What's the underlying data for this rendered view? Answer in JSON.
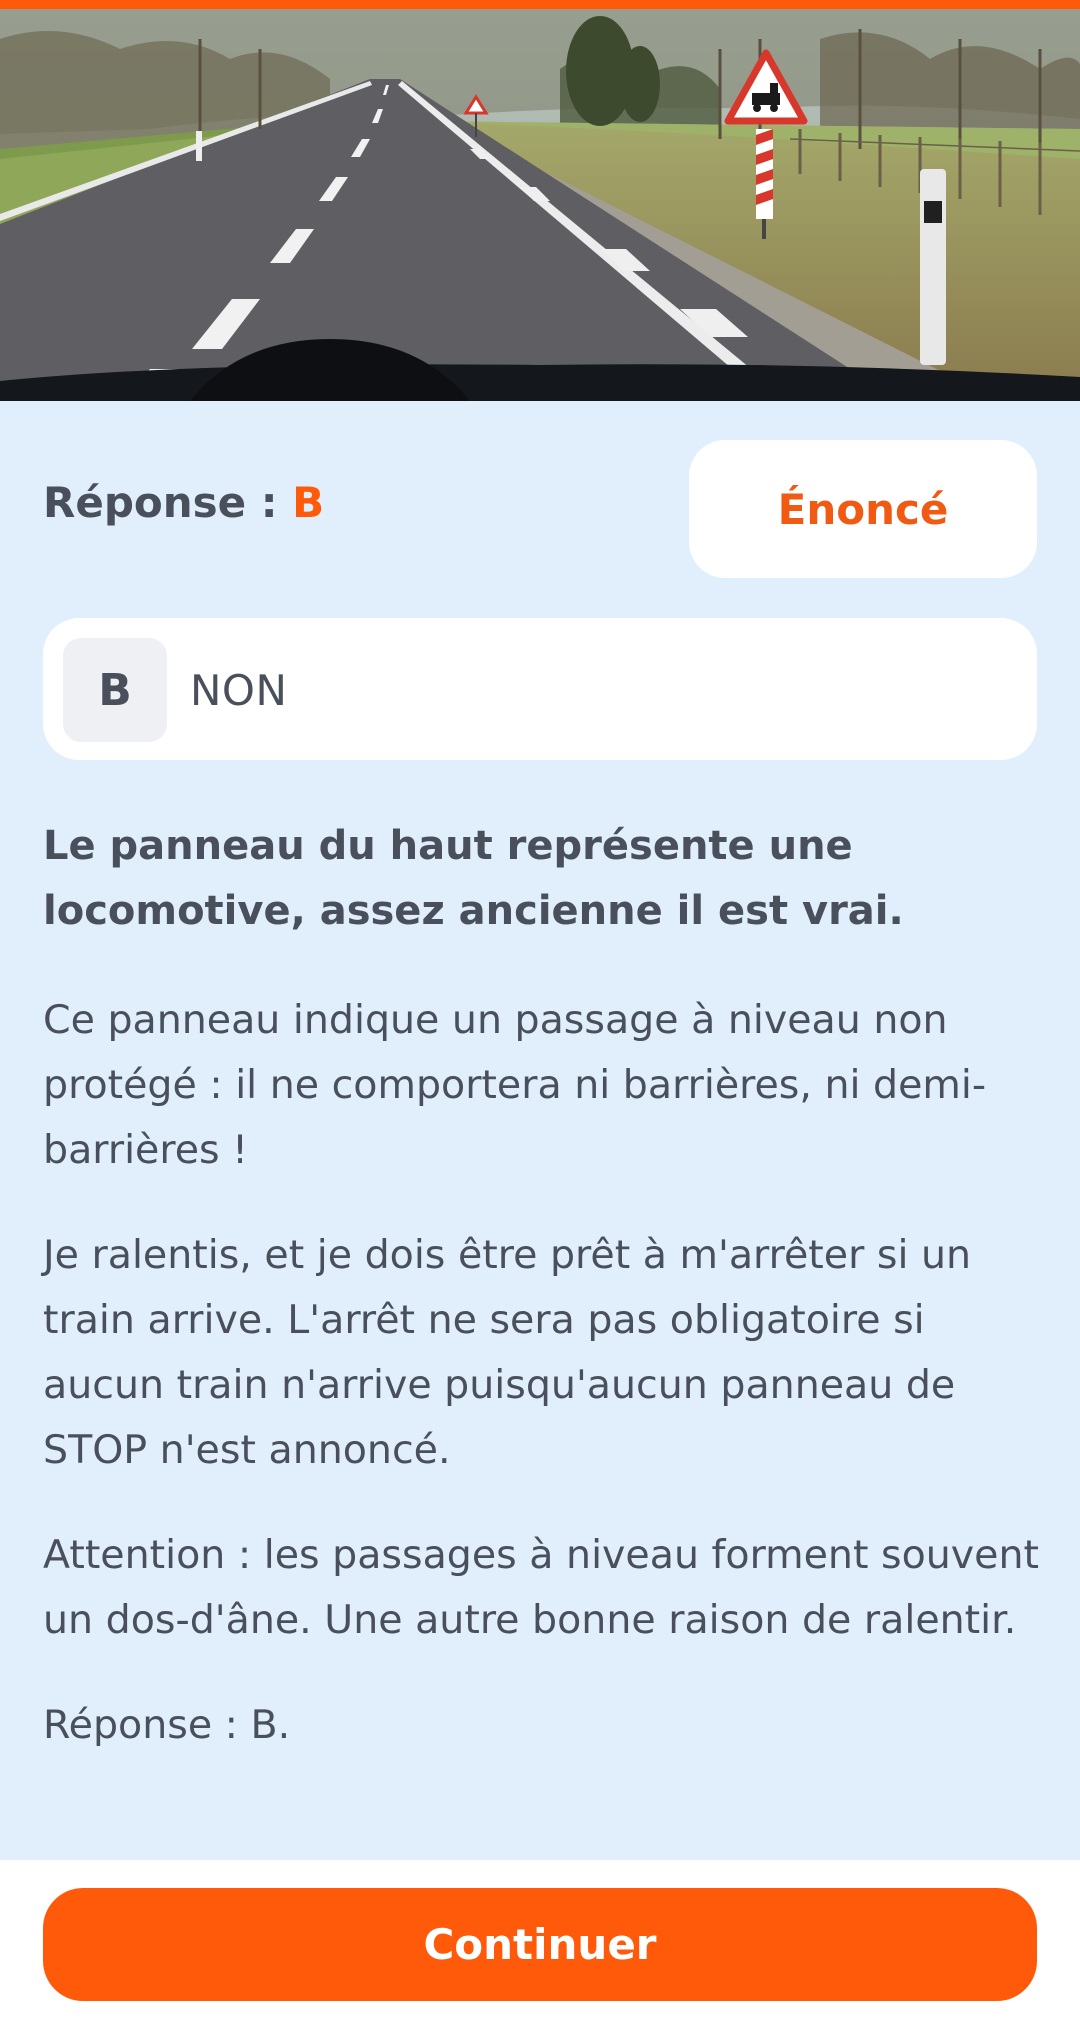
{
  "header_image": {
    "icon": "road-with-level-crossing-sign-photo",
    "description_colors": {
      "sky": "#c9d2cc",
      "road": "#5f5f63",
      "dashboard": "#14171c"
    }
  },
  "answer": {
    "prefix": "Réponse : ",
    "letter": "B"
  },
  "statement_button": {
    "label": "Énoncé"
  },
  "choice": {
    "letter": "B",
    "text": "NON"
  },
  "explanation": {
    "lead": "Le panneau du haut représente une locomotive, assez ancienne il est vrai.",
    "paragraphs": [
      "Ce panneau indique un passage à niveau non protégé : il ne comportera ni barrières, ni demi-barrières !",
      "Je ralentis, et je dois être prêt à m'arrêter si un train arrive. L'arrêt ne sera pas obligatoire si aucun train n'arrive puisqu'aucun panneau de STOP n'est annoncé.",
      "Attention : les passages à niveau forment souvent un dos-d'âne. Une autre bonne raison de ralentir.",
      "Réponse : B."
    ]
  },
  "footer": {
    "continue_label": "Continuer"
  },
  "colors": {
    "accent": "#ff5a0a",
    "background": "#e1effd",
    "card": "#ffffff",
    "text": "#4a4f5c"
  }
}
